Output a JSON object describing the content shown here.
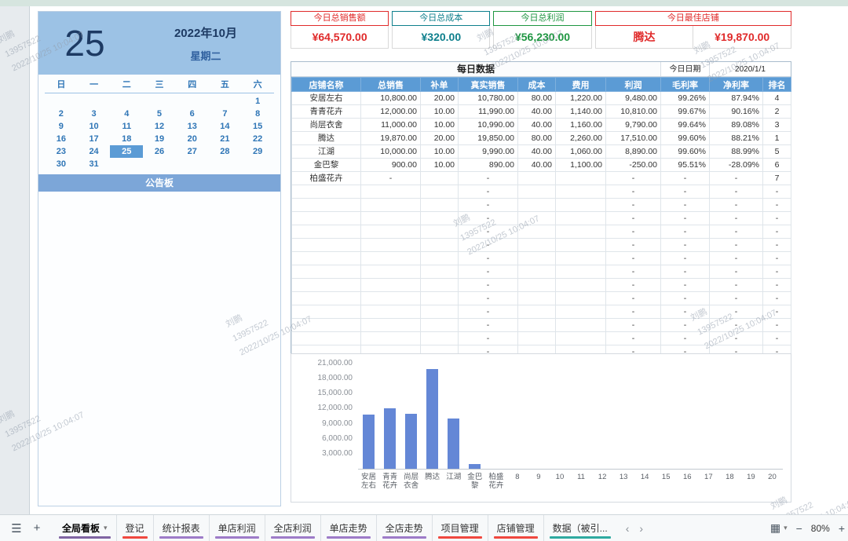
{
  "watermark": {
    "line1": "刘鹏",
    "line2": "13957522",
    "line3": "2022/10/25 10:04:07"
  },
  "calendar": {
    "day_number": "25",
    "month_label": "2022年10月",
    "weekday_label": "星期二",
    "day_headers": [
      "日",
      "一",
      "二",
      "三",
      "四",
      "五",
      "六"
    ],
    "weeks": [
      [
        "",
        "",
        "",
        "",
        "",
        "",
        "1"
      ],
      [
        "2",
        "3",
        "4",
        "5",
        "6",
        "7",
        "8"
      ],
      [
        "9",
        "10",
        "11",
        "12",
        "13",
        "14",
        "15"
      ],
      [
        "16",
        "17",
        "18",
        "19",
        "20",
        "21",
        "22"
      ],
      [
        "23",
        "24",
        "25",
        "26",
        "27",
        "28",
        "29"
      ],
      [
        "30",
        "31",
        "",
        "",
        "",
        "",
        ""
      ]
    ],
    "selected_day": "25",
    "notice_title": "公告板",
    "notice_content": ""
  },
  "summary_cards": {
    "cards": [
      {
        "label": "今日总销售额",
        "value": "¥64,570.00",
        "color": "#e02a2a"
      },
      {
        "label": "今日总成本",
        "value": "¥320.00",
        "color": "#0e7f8c"
      },
      {
        "label": "今日总利润",
        "value": "¥56,230.00",
        "color": "#1e9641"
      }
    ],
    "best_shop": {
      "label": "今日最佳店铺",
      "name": "腾达",
      "amount": "¥19,870.00",
      "color": "#e02a2a"
    }
  },
  "daily_table": {
    "title": "每日数据",
    "date_label": "今日日期",
    "date_value": "2020/1/1",
    "headers": [
      "店铺名称",
      "总销售",
      "补单",
      "真实销售",
      "成本",
      "费用",
      "利润",
      "毛利率",
      "净利率",
      "排名"
    ],
    "rows": [
      [
        "安居左右",
        "10,800.00",
        "20.00",
        "10,780.00",
        "80.00",
        "1,220.00",
        "9,480.00",
        "99.26%",
        "87.94%",
        "4"
      ],
      [
        "青青花卉",
        "12,000.00",
        "10.00",
        "11,990.00",
        "40.00",
        "1,140.00",
        "10,810.00",
        "99.67%",
        "90.16%",
        "2"
      ],
      [
        "尚层衣舍",
        "11,000.00",
        "10.00",
        "10,990.00",
        "40.00",
        "1,160.00",
        "9,790.00",
        "99.64%",
        "89.08%",
        "3"
      ],
      [
        "腾达",
        "19,870.00",
        "20.00",
        "19,850.00",
        "80.00",
        "2,260.00",
        "17,510.00",
        "99.60%",
        "88.21%",
        "1"
      ],
      [
        "江湖",
        "10,000.00",
        "10.00",
        "9,990.00",
        "40.00",
        "1,060.00",
        "8,890.00",
        "99.60%",
        "88.99%",
        "5"
      ],
      [
        "金巴黎",
        "900.00",
        "10.00",
        "890.00",
        "40.00",
        "1,100.00",
        "-250.00",
        "95.51%",
        "-28.09%",
        "6"
      ],
      [
        "柏盛花卉",
        "-",
        "",
        "-",
        "",
        "",
        "-",
        "-",
        "-",
        "7"
      ],
      [
        "",
        "",
        "",
        "-",
        "",
        "",
        "-",
        "-",
        "-",
        "-"
      ],
      [
        "",
        "",
        "",
        "-",
        "",
        "",
        "-",
        "-",
        "-",
        "-"
      ],
      [
        "",
        "",
        "",
        "-",
        "",
        "",
        "-",
        "-",
        "-",
        "-"
      ],
      [
        "",
        "",
        "",
        "-",
        "",
        "",
        "-",
        "-",
        "-",
        "-"
      ],
      [
        "",
        "",
        "",
        "-",
        "",
        "",
        "-",
        "-",
        "-",
        "-"
      ],
      [
        "",
        "",
        "",
        "-",
        "",
        "",
        "-",
        "-",
        "-",
        "-"
      ],
      [
        "",
        "",
        "",
        "-",
        "",
        "",
        "-",
        "-",
        "-",
        "-"
      ],
      [
        "",
        "",
        "",
        "-",
        "",
        "",
        "-",
        "-",
        "-",
        "-"
      ],
      [
        "",
        "",
        "",
        "-",
        "",
        "",
        "-",
        "-",
        "-",
        "-"
      ],
      [
        "",
        "",
        "",
        "-",
        "",
        "",
        "-",
        "-",
        "-",
        "-"
      ],
      [
        "",
        "",
        "",
        "-",
        "",
        "",
        "-",
        "-",
        "-",
        "-"
      ],
      [
        "",
        "",
        "",
        "-",
        "",
        "",
        "-",
        "-",
        "-",
        "-"
      ],
      [
        "",
        "",
        "",
        "-",
        "",
        "",
        "-",
        "-",
        "-",
        "-"
      ]
    ]
  },
  "chart_data": {
    "type": "bar",
    "title": "",
    "xlabel": "",
    "ylabel": "",
    "categories": [
      "安居左右",
      "青青花卉",
      "尚层衣舍",
      "腾达",
      "江湖",
      "金巴黎",
      "柏盛花卉",
      "8",
      "9",
      "10",
      "11",
      "12",
      "13",
      "14",
      "15",
      "16",
      "17",
      "18",
      "19",
      "20"
    ],
    "values": [
      10800,
      12000,
      11000,
      19870,
      10000,
      900,
      0,
      0,
      0,
      0,
      0,
      0,
      0,
      0,
      0,
      0,
      0,
      0,
      0,
      0
    ],
    "ylim": [
      0,
      21000
    ],
    "ytick_step": 3000,
    "ytick_labels": [
      "21,000.00",
      "18,000.00",
      "15,000.00",
      "12,000.00",
      "9,000.00",
      "6,000.00",
      "3,000.00"
    ],
    "bar_color": "#6487d6",
    "grid": false,
    "legend": "none"
  },
  "tabbar": {
    "icons": {
      "menu": "☰",
      "add_sheet": "+",
      "prev": "‹",
      "next": "›",
      "grid_view": "▦",
      "dropdown": "▾",
      "zoom_out": "−",
      "zoom_in": "+"
    },
    "tabs": [
      {
        "label": "全局看板",
        "underline": "#8064a2",
        "active": true,
        "dropdown": true
      },
      {
        "label": "登记",
        "underline": "#f0483f"
      },
      {
        "label": "统计报表",
        "underline": "#9d7bc8"
      },
      {
        "label": "单店利润",
        "underline": "#9d7bc8"
      },
      {
        "label": "全店利润",
        "underline": "#9d7bc8"
      },
      {
        "label": "单店走势",
        "underline": "#9d7bc8"
      },
      {
        "label": "全店走势",
        "underline": "#9d7bc8"
      },
      {
        "label": "项目管理",
        "underline": "#f0483f"
      },
      {
        "label": "店铺管理",
        "underline": "#f0483f"
      },
      {
        "label": "数据（被引...",
        "underline": "#2faaa0"
      }
    ],
    "zoom_level": "80%"
  }
}
